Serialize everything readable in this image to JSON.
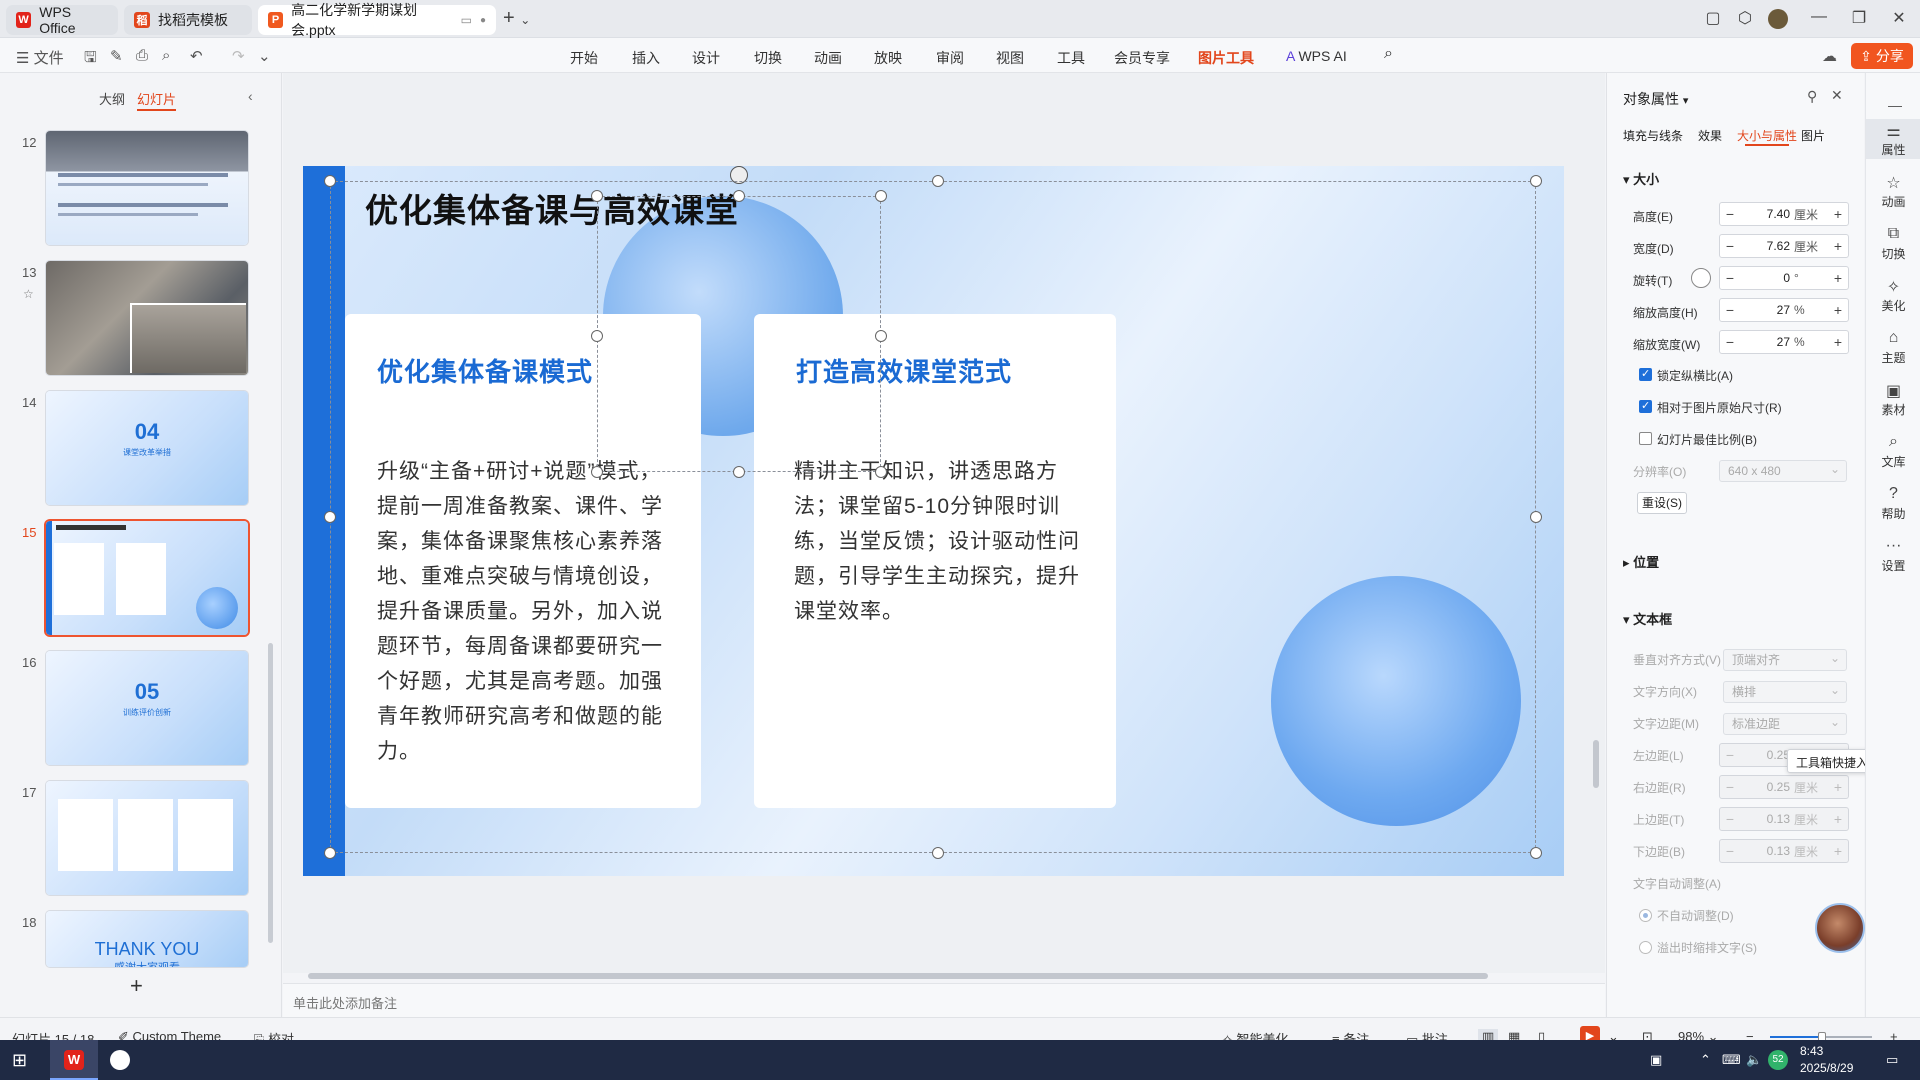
{
  "tabs": [
    {
      "label": "WPS Office"
    },
    {
      "label": "找稻壳模板"
    },
    {
      "label": "高二化学新学期谋划会.pptx"
    }
  ],
  "new_tab": "+",
  "menu": {
    "file": "文件",
    "items": [
      "开始",
      "插入",
      "设计",
      "切换",
      "动画",
      "放映",
      "审阅",
      "视图",
      "工具",
      "会员专享",
      "图片工具",
      "WPS AI"
    ],
    "active": "图片工具",
    "share": "分享"
  },
  "left_panel": {
    "tab_outline": "大纲",
    "tab_slides": "幻灯片",
    "slides": [
      {
        "num": "12"
      },
      {
        "num": "13"
      },
      {
        "num": "14",
        "big": "04",
        "small": "课堂改革举措"
      },
      {
        "num": "15"
      },
      {
        "num": "16",
        "big": "05",
        "small": "训练评价创新"
      },
      {
        "num": "17"
      },
      {
        "num": "18",
        "big": "THANK YOU",
        "small": "感谢大家观看"
      }
    ],
    "add": "+"
  },
  "slide": {
    "title": "优化集体备课与高效课堂",
    "card1_title": "优化集体备课模式",
    "card1_body": "升级“主备+研讨+说题”模式，提前一周准备教案、课件、学案，集体备课聚焦核心素养落地、重难点突破与情境创设，提升备课质量。另外，加入说题环节，每周备课都要研究一个好题，尤其是高考题。加强青年教师研究高考和做题的能力。",
    "card2_title": "打造高效课堂范式",
    "card2_body": "精讲主干知识，讲透思路方法；课堂留5-10分钟限时训练，当堂反馈；设计驱动性问题，引导学生主动探究，提升课堂效率。"
  },
  "notes_placeholder": "单击此处添加备注",
  "right_panel": {
    "header": "对象属性",
    "tabs": [
      "填充与线条",
      "效果",
      "大小与属性",
      "图片"
    ],
    "active_tab": "大小与属性",
    "size_section": "大小",
    "height_label": "高度(E)",
    "height_value": "7.40",
    "height_unit": "厘米",
    "width_label": "宽度(D)",
    "width_value": "7.62",
    "width_unit": "厘米",
    "rotate_label": "旋转(T)",
    "rotate_value": "0",
    "rotate_unit": "°",
    "scale_h_label": "缩放高度(H)",
    "scale_h_value": "27",
    "scale_h_unit": "%",
    "scale_w_label": "缩放宽度(W)",
    "scale_w_value": "27",
    "scale_w_unit": "%",
    "lock_ratio": "锁定纵横比(A)",
    "relative_original": "相对于图片原始尺寸(R)",
    "best_scale": "幻灯片最佳比例(B)",
    "resolution_label": "分辨率(O)",
    "resolution_value": "640 x 480",
    "reset": "重设(S)",
    "position_section": "位置",
    "textbox_section": "文本框",
    "valign_label": "垂直对齐方式(V)",
    "valign_value": "顶端对齐",
    "textdir_label": "文字方向(X)",
    "textdir_value": "横排",
    "margin_label": "文字边距(M)",
    "margin_value": "标准边距",
    "left_label": "左边距(L)",
    "left_value": "0.25",
    "right_label": "右边距(R)",
    "right_value": "0.25",
    "top_label": "上边距(T)",
    "top_value": "0.13",
    "bottom_label": "下边距(B)",
    "bottom_value": "0.13",
    "unit_cm": "厘米",
    "autofit_label": "文字自动调整(A)",
    "no_autofit": "不自动调整(D)",
    "shrink_overflow": "溢出时缩排文字(S)",
    "tooltip": "工具箱快捷入口"
  },
  "side_rail": [
    "属性",
    "动画",
    "切换",
    "美化",
    "主题",
    "素材",
    "文库",
    "帮助",
    "设置"
  ],
  "status": {
    "slide_info": "幻灯片 15 / 18",
    "theme": "Custom Theme",
    "proof": "校对",
    "beautify": "智能美化",
    "notes": "备注",
    "comment": "批注",
    "zoom": "98%"
  },
  "taskbar": {
    "time": "8:43",
    "date": "2025/8/29",
    "badge": "52"
  }
}
